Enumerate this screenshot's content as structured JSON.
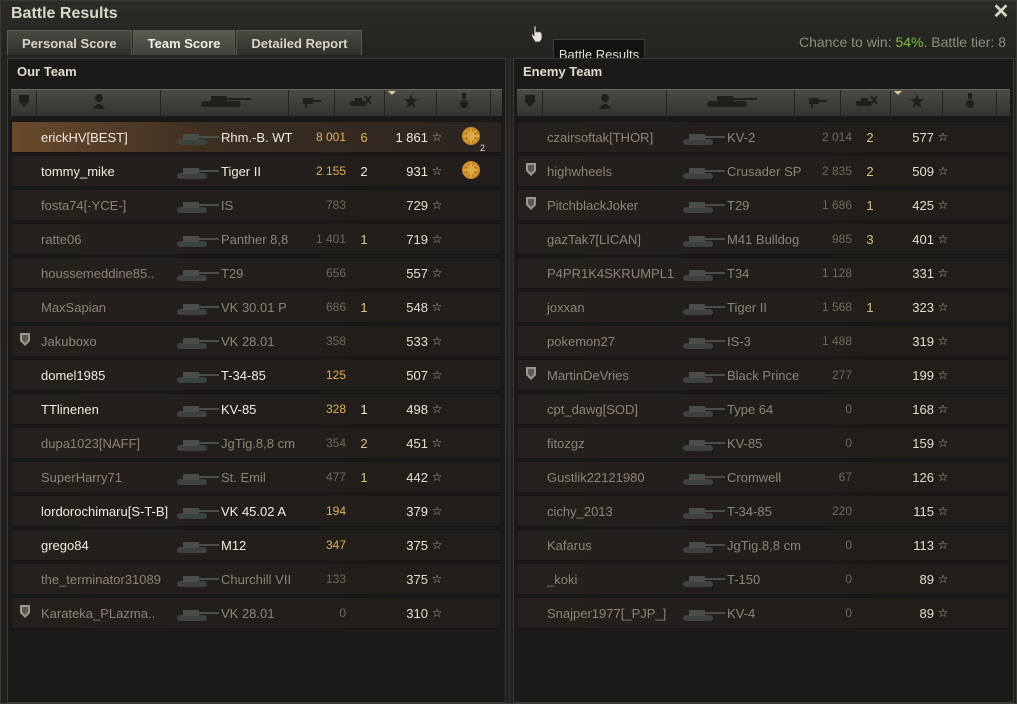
{
  "window": {
    "title": "Battle Results",
    "close_label": "✕"
  },
  "tabs": [
    {
      "label": "Personal Score",
      "active": false
    },
    {
      "label": "Team Score",
      "active": true
    },
    {
      "label": "Detailed Report",
      "active": false
    }
  ],
  "summary": {
    "chance_label": "Chance to win: ",
    "chance_value": "54%",
    "tier_label": ". Battle tier: 8"
  },
  "tooltip": {
    "text": "Battle Results"
  },
  "colors": {
    "win_chance": "#7fbf40",
    "damage_alive": "#e4b05a",
    "self_row": "#6a4a2c"
  },
  "header_icons": [
    "squad-icon",
    "player-icon",
    "tank-icon",
    "damage-icon",
    "kills-icon",
    "xp-star-icon",
    "medal-icon"
  ],
  "our_team": {
    "title": "Our Team",
    "rows": [
      {
        "name": "erickHV[BEST]",
        "tank": "Rhm.-B. WT",
        "damage": "8 001",
        "kills": "6",
        "xp": "1 861",
        "alive": true,
        "self": true,
        "squad": false,
        "medal": true,
        "medal_count": "2"
      },
      {
        "name": "tommy_mike",
        "tank": "Tiger II",
        "damage": "2 155",
        "kills": "2",
        "xp": "931",
        "alive": true,
        "self": false,
        "squad": false,
        "medal": true,
        "medal_count": ""
      },
      {
        "name": "fosta74[-YCE-]",
        "tank": "IS",
        "damage": "783",
        "kills": "",
        "xp": "729",
        "alive": false,
        "self": false,
        "squad": false,
        "medal": false
      },
      {
        "name": "ratte06",
        "tank": "Panther 8,8",
        "damage": "1 401",
        "kills": "1",
        "xp": "719",
        "alive": false,
        "self": false,
        "squad": false,
        "medal": false
      },
      {
        "name": "houssemeddine85..",
        "tank": "T29",
        "damage": "656",
        "kills": "",
        "xp": "557",
        "alive": false,
        "self": false,
        "squad": false,
        "medal": false
      },
      {
        "name": "MaxSapian",
        "tank": "VK 30.01 P",
        "damage": "686",
        "kills": "1",
        "xp": "548",
        "alive": false,
        "self": false,
        "squad": false,
        "medal": false
      },
      {
        "name": "Jakuboxo",
        "tank": "VK 28.01",
        "damage": "358",
        "kills": "",
        "xp": "533",
        "alive": false,
        "self": false,
        "squad": true,
        "medal": false
      },
      {
        "name": "domel1985",
        "tank": "T-34-85",
        "damage": "125",
        "kills": "",
        "xp": "507",
        "alive": true,
        "self": false,
        "squad": false,
        "medal": false
      },
      {
        "name": "TTlinenen",
        "tank": "KV-85",
        "damage": "328",
        "kills": "1",
        "xp": "498",
        "alive": true,
        "self": false,
        "squad": false,
        "medal": false
      },
      {
        "name": "dupa1023[NAFF]",
        "tank": "JgTig.8,8 cm",
        "damage": "354",
        "kills": "2",
        "xp": "451",
        "alive": false,
        "self": false,
        "squad": false,
        "medal": false
      },
      {
        "name": "SuperHarry71",
        "tank": "St. Emil",
        "damage": "477",
        "kills": "1",
        "xp": "442",
        "alive": false,
        "self": false,
        "squad": false,
        "medal": false
      },
      {
        "name": "lordorochimaru[S-T-B]",
        "tank": "VK 45.02 A",
        "damage": "194",
        "kills": "",
        "xp": "379",
        "alive": true,
        "self": false,
        "squad": false,
        "medal": false
      },
      {
        "name": "grego84",
        "tank": "M12",
        "damage": "347",
        "kills": "",
        "xp": "375",
        "alive": true,
        "self": false,
        "squad": false,
        "medal": false
      },
      {
        "name": "the_terminator31089",
        "tank": "Churchill VII",
        "damage": "133",
        "kills": "",
        "xp": "375",
        "alive": false,
        "self": false,
        "squad": false,
        "medal": false
      },
      {
        "name": "Karateka_PLazma..",
        "tank": "VK 28.01",
        "damage": "0",
        "kills": "",
        "xp": "310",
        "alive": false,
        "self": false,
        "squad": true,
        "medal": false
      }
    ]
  },
  "enemy_team": {
    "title": "Enemy Team",
    "rows": [
      {
        "name": "czairsoftak[THOR]",
        "tank": "KV-2",
        "damage": "2 014",
        "kills": "2",
        "xp": "577",
        "alive": false,
        "squad": false
      },
      {
        "name": "highwheels",
        "tank": "Crusader SP",
        "damage": "2 835",
        "kills": "2",
        "xp": "509",
        "alive": false,
        "squad": true
      },
      {
        "name": "PitchblackJoker",
        "tank": "T29",
        "damage": "1 686",
        "kills": "1",
        "xp": "425",
        "alive": false,
        "squad": true
      },
      {
        "name": "gazTak7[LICAN]",
        "tank": "M41 Bulldog",
        "damage": "985",
        "kills": "3",
        "xp": "401",
        "alive": false,
        "squad": false
      },
      {
        "name": "P4PR1K4SKRUMPL1",
        "tank": "T34",
        "damage": "1 128",
        "kills": "",
        "xp": "331",
        "alive": false,
        "squad": false
      },
      {
        "name": "joxxan",
        "tank": "Tiger II",
        "damage": "1 568",
        "kills": "1",
        "xp": "323",
        "alive": false,
        "squad": false
      },
      {
        "name": "pokemon27",
        "tank": "IS-3",
        "damage": "1 488",
        "kills": "",
        "xp": "319",
        "alive": false,
        "squad": false
      },
      {
        "name": "MartinDeVries",
        "tank": "Black Prince",
        "damage": "277",
        "kills": "",
        "xp": "199",
        "alive": false,
        "squad": true
      },
      {
        "name": "cpt_dawg[SOD]",
        "tank": "Type 64",
        "damage": "0",
        "kills": "",
        "xp": "168",
        "alive": false,
        "squad": false
      },
      {
        "name": "fitozgz",
        "tank": "KV-85",
        "damage": "0",
        "kills": "",
        "xp": "159",
        "alive": false,
        "squad": false
      },
      {
        "name": "Gustlik22121980",
        "tank": "Cromwell",
        "damage": "67",
        "kills": "",
        "xp": "126",
        "alive": false,
        "squad": false
      },
      {
        "name": "cichy_2013",
        "tank": "T-34-85",
        "damage": "220",
        "kills": "",
        "xp": "115",
        "alive": false,
        "squad": false
      },
      {
        "name": "Kafarus",
        "tank": "JgTig.8,8 cm",
        "damage": "0",
        "kills": "",
        "xp": "113",
        "alive": false,
        "squad": false
      },
      {
        "name": "_koki",
        "tank": "T-150",
        "damage": "0",
        "kills": "",
        "xp": "89",
        "alive": false,
        "squad": false
      },
      {
        "name": "Snajper1977[_PJP_]",
        "tank": "KV-4",
        "damage": "0",
        "kills": "",
        "xp": "89",
        "alive": false,
        "squad": false
      }
    ]
  }
}
